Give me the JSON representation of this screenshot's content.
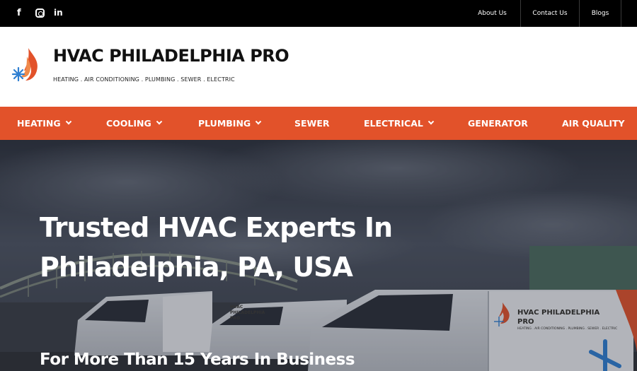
{
  "topbar": {
    "social": [
      {
        "icon": "facebook-icon",
        "glyph": "f"
      },
      {
        "icon": "instagram-icon",
        "glyph": ""
      },
      {
        "icon": "linkedin-icon",
        "glyph": "in"
      }
    ],
    "links": [
      "About Us",
      "Contact Us",
      "Blogs"
    ]
  },
  "header": {
    "title": "HVAC PHILADELPHIA PRO",
    "tagline": "HEATING . AIR CONDITIONING . PLUMBING . SEWER . ELECTRIC",
    "logo_icon": "flame-snowflake-logo-icon"
  },
  "nav": {
    "items": [
      {
        "label": "HEATING",
        "dropdown": true
      },
      {
        "label": "COOLING",
        "dropdown": true
      },
      {
        "label": "PLUMBING",
        "dropdown": true
      },
      {
        "label": "SEWER",
        "dropdown": false
      },
      {
        "label": "ELECTRICAL",
        "dropdown": true
      },
      {
        "label": "GENERATOR",
        "dropdown": false
      },
      {
        "label": "AIR QUALITY",
        "dropdown": false
      }
    ]
  },
  "hero": {
    "headline": "Trusted HVAC Experts In Philadelphia, PA, USA",
    "subheadline": "For More Than 15 Years In Business",
    "van_brand": "HVAC PHILADELPHIA PRO",
    "van_tagline": "HEATING . AIR CONDITIONING . PLUMBING . SEWER . ELECTRIC",
    "van_brand_small": "HVAC PHILADELPHIA PRO"
  },
  "colors": {
    "accent": "#e2522a",
    "topbar": "#000000",
    "logo_blue": "#2f7fd1"
  }
}
